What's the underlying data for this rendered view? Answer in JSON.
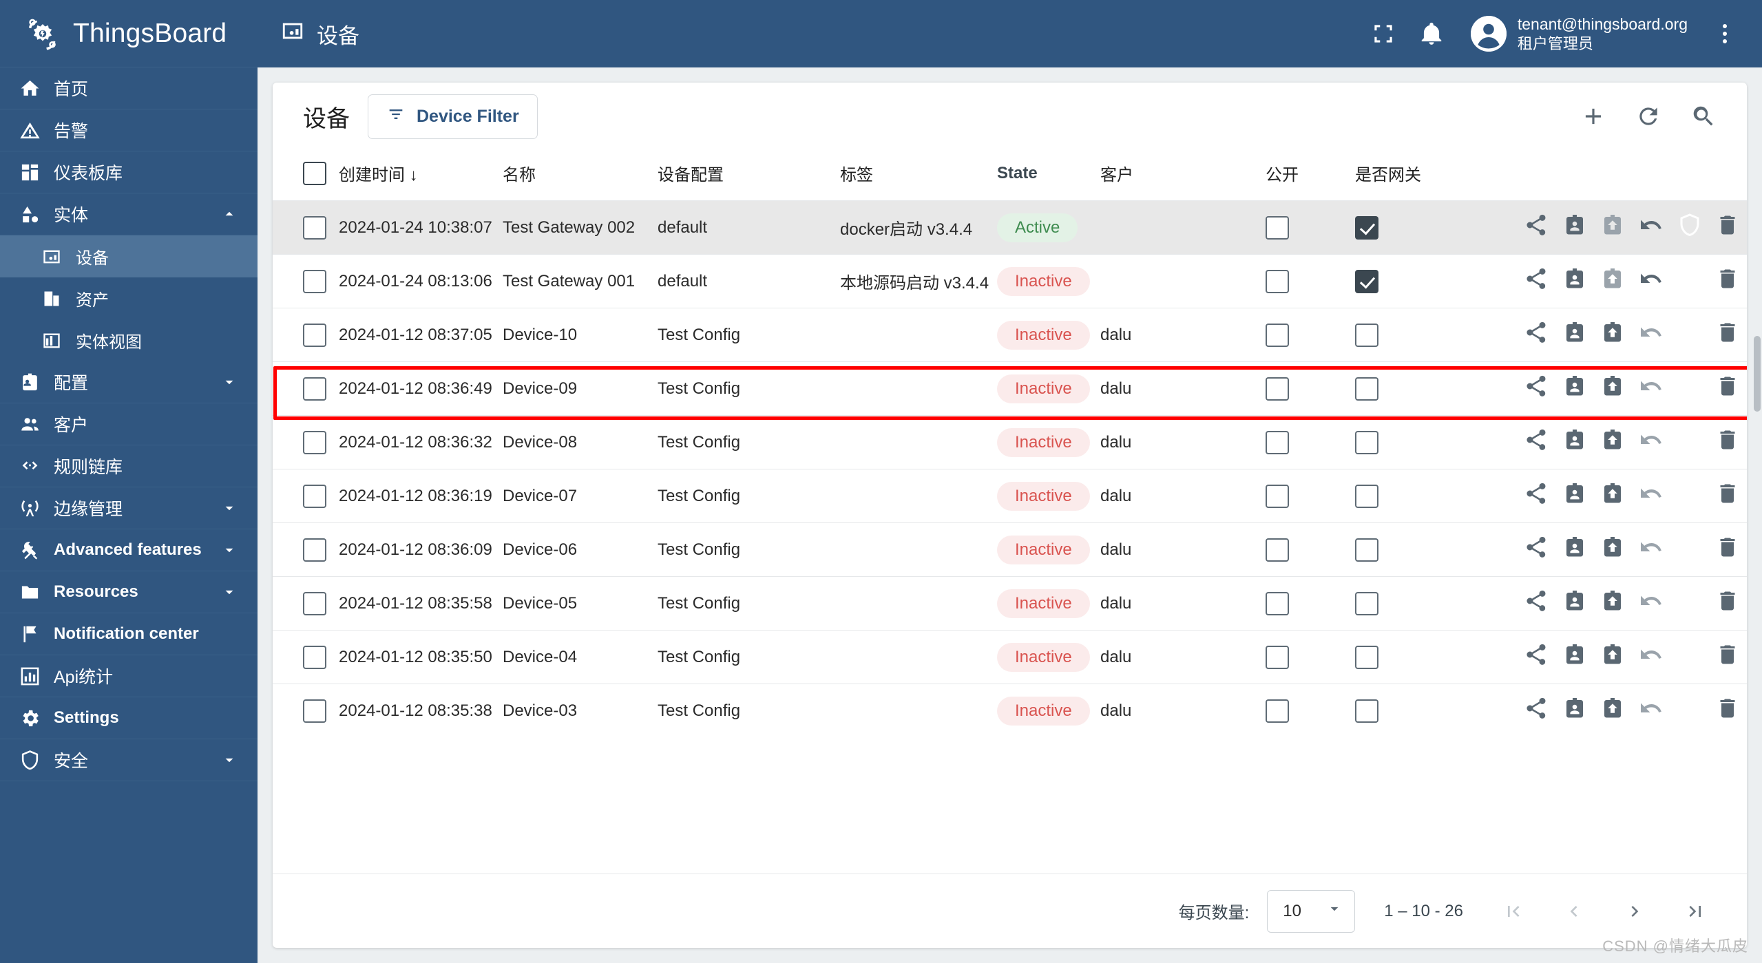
{
  "brand": {
    "name": "ThingsBoard",
    "logo_icon": "thingsboard-logo-icon"
  },
  "topbar": {
    "title": "设备",
    "title_icon": "device-icon",
    "fullscreen_icon": "fullscreen-icon",
    "notifications_icon": "bell-icon",
    "avatar_icon": "account-circle-icon",
    "user_email": "tenant@thingsboard.org",
    "user_role": "租户管理员",
    "more_icon": "kebab-menu-icon"
  },
  "sidebar": {
    "items": [
      {
        "label": "首页",
        "icon": "home-icon",
        "level": "top",
        "expandable": false,
        "active": false
      },
      {
        "label": "告警",
        "icon": "alarm-warning-icon",
        "level": "top",
        "expandable": false,
        "active": false
      },
      {
        "label": "仪表板库",
        "icon": "dashboard-icon",
        "level": "top",
        "expandable": false,
        "active": false
      },
      {
        "label": "实体",
        "icon": "entity-shapes-icon",
        "level": "top",
        "expandable": true,
        "expanded": true,
        "active": false
      },
      {
        "label": "设备",
        "icon": "device-icon",
        "level": "sub",
        "expandable": false,
        "active": true
      },
      {
        "label": "资产",
        "icon": "asset-building-icon",
        "level": "sub",
        "expandable": false,
        "active": false
      },
      {
        "label": "实体视图",
        "icon": "entity-view-icon",
        "level": "sub",
        "expandable": false,
        "active": false
      },
      {
        "label": "配置",
        "icon": "profile-card-icon",
        "level": "top",
        "expandable": true,
        "expanded": false,
        "active": false
      },
      {
        "label": "客户",
        "icon": "customers-icon",
        "level": "top",
        "expandable": false,
        "active": false
      },
      {
        "label": "规则链库",
        "icon": "rule-chain-icon",
        "level": "top",
        "expandable": false,
        "active": false
      },
      {
        "label": "边缘管理",
        "icon": "edge-antenna-icon",
        "level": "top",
        "expandable": true,
        "expanded": false,
        "active": false
      },
      {
        "label": "Advanced features",
        "icon": "tools-icon",
        "level": "top",
        "expandable": true,
        "expanded": false,
        "active": false,
        "latin": true
      },
      {
        "label": "Resources",
        "icon": "folder-icon",
        "level": "top",
        "expandable": true,
        "expanded": false,
        "active": false,
        "latin": true
      },
      {
        "label": "Notification center",
        "icon": "flag-icon",
        "level": "top",
        "expandable": false,
        "active": false,
        "latin": true
      },
      {
        "label": "Api统计",
        "icon": "api-usage-icon",
        "level": "top",
        "expandable": false,
        "active": false
      },
      {
        "label": "Settings",
        "icon": "gear-icon",
        "level": "top",
        "expandable": false,
        "active": false,
        "latin": true
      },
      {
        "label": "安全",
        "icon": "shield-icon",
        "level": "top",
        "expandable": true,
        "expanded": false,
        "active": false
      }
    ]
  },
  "card": {
    "title": "设备",
    "filter_button": {
      "label": "Device Filter",
      "icon": "filter-icon"
    },
    "actions": [
      {
        "name": "add-device-button",
        "icon": "plus-icon"
      },
      {
        "name": "refresh-button",
        "icon": "refresh-icon"
      },
      {
        "name": "search-button",
        "icon": "search-icon"
      }
    ]
  },
  "table": {
    "columns": [
      {
        "key": "select",
        "label": ""
      },
      {
        "key": "created",
        "label": "创建时间",
        "sorted": true,
        "sort_dir": "desc",
        "sort_glyph": "↓"
      },
      {
        "key": "name",
        "label": "名称"
      },
      {
        "key": "profile",
        "label": "设备配置"
      },
      {
        "key": "label",
        "label": "标签"
      },
      {
        "key": "state",
        "label": "State"
      },
      {
        "key": "customer",
        "label": "客户"
      },
      {
        "key": "public",
        "label": "公开"
      },
      {
        "key": "gateway",
        "label": "是否网关"
      },
      {
        "key": "actions",
        "label": ""
      }
    ],
    "row_actions": [
      {
        "name": "share-action",
        "icon": "share-icon"
      },
      {
        "name": "manage-creds-action",
        "icon": "clipboard-person-icon"
      },
      {
        "name": "assign-action",
        "icon": "clipboard-arrow-icon"
      },
      {
        "name": "unassign-action",
        "icon": "undo-arrow-icon"
      },
      {
        "name": "credentials-action",
        "icon": "shield-icon"
      },
      {
        "name": "delete-action",
        "icon": "trash-icon"
      }
    ],
    "rows": [
      {
        "created": "2024-01-24 10:38:07",
        "name": "Test Gateway 002",
        "profile": "default",
        "label": "docker启动 v3.4.4",
        "state": "Active",
        "state_kind": "active",
        "customer": "",
        "public": false,
        "gateway": true,
        "selected": false,
        "highlighted": true,
        "assign_dim": true
      },
      {
        "created": "2024-01-24 08:13:06",
        "name": "Test Gateway 001",
        "profile": "default",
        "label": "本地源码启动 v3.4.4",
        "state": "Inactive",
        "state_kind": "inactive",
        "customer": "",
        "public": false,
        "gateway": true,
        "selected": false,
        "highlighted": false,
        "assign_dim": true
      },
      {
        "created": "2024-01-12 08:37:05",
        "name": "Device-10",
        "profile": "Test Config",
        "label": "",
        "state": "Inactive",
        "state_kind": "inactive",
        "customer": "dalu",
        "public": false,
        "gateway": false,
        "selected": false,
        "highlighted": false,
        "assign_dim": false
      },
      {
        "created": "2024-01-12 08:36:49",
        "name": "Device-09",
        "profile": "Test Config",
        "label": "",
        "state": "Inactive",
        "state_kind": "inactive",
        "customer": "dalu",
        "public": false,
        "gateway": false,
        "selected": false,
        "highlighted": false,
        "assign_dim": false
      },
      {
        "created": "2024-01-12 08:36:32",
        "name": "Device-08",
        "profile": "Test Config",
        "label": "",
        "state": "Inactive",
        "state_kind": "inactive",
        "customer": "dalu",
        "public": false,
        "gateway": false,
        "selected": false,
        "highlighted": false,
        "assign_dim": false
      },
      {
        "created": "2024-01-12 08:36:19",
        "name": "Device-07",
        "profile": "Test Config",
        "label": "",
        "state": "Inactive",
        "state_kind": "inactive",
        "customer": "dalu",
        "public": false,
        "gateway": false,
        "selected": false,
        "highlighted": false,
        "assign_dim": false
      },
      {
        "created": "2024-01-12 08:36:09",
        "name": "Device-06",
        "profile": "Test Config",
        "label": "",
        "state": "Inactive",
        "state_kind": "inactive",
        "customer": "dalu",
        "public": false,
        "gateway": false,
        "selected": false,
        "highlighted": false,
        "assign_dim": false
      },
      {
        "created": "2024-01-12 08:35:58",
        "name": "Device-05",
        "profile": "Test Config",
        "label": "",
        "state": "Inactive",
        "state_kind": "inactive",
        "customer": "dalu",
        "public": false,
        "gateway": false,
        "selected": false,
        "highlighted": false,
        "assign_dim": false
      },
      {
        "created": "2024-01-12 08:35:50",
        "name": "Device-04",
        "profile": "Test Config",
        "label": "",
        "state": "Inactive",
        "state_kind": "inactive",
        "customer": "dalu",
        "public": false,
        "gateway": false,
        "selected": false,
        "highlighted": false,
        "assign_dim": false
      },
      {
        "created": "2024-01-12 08:35:38",
        "name": "Device-03",
        "profile": "Test Config",
        "label": "",
        "state": "Inactive",
        "state_kind": "inactive",
        "customer": "dalu",
        "public": false,
        "gateway": false,
        "selected": false,
        "highlighted": false,
        "assign_dim": false
      }
    ]
  },
  "paginator": {
    "items_per_page_label": "每页数量:",
    "page_size": "10",
    "range_label": "1 – 10 - 26",
    "first_icon": "first-page-icon",
    "prev_icon": "prev-page-icon",
    "next_icon": "next-page-icon",
    "last_icon": "last-page-icon"
  },
  "watermark": "CSDN @情绪大瓜皮",
  "colors": {
    "brand_blue": "#305680",
    "active_green": "#3f8c50",
    "inactive_red": "#d9534f",
    "annotation_red": "#ff0000"
  }
}
